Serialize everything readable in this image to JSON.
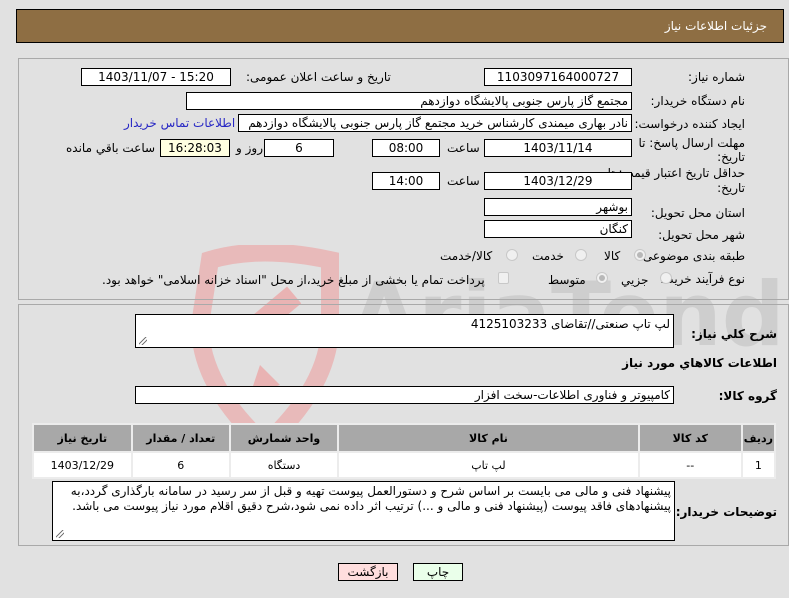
{
  "header": {
    "title": "جزئیات اطلاعات نیاز"
  },
  "form": {
    "need_number": {
      "label": "شماره نیاز:",
      "value": "1103097164000727"
    },
    "announce": {
      "label": "تاریخ و ساعت اعلان عمومی:",
      "value": "1403/11/07 - 15:20"
    },
    "buyer_org": {
      "label": "نام دستگاه خریدار:",
      "value": "مجتمع گاز پارس جنوبی  پالایشگاه دوازدهم"
    },
    "requester": {
      "label": "ایجاد کننده درخواست:",
      "value": "نادر بهاری میمندی کارشناس خرید مجتمع گاز پارس جنوبی  پالایشگاه دوازدهم",
      "contact_link": "اطلاعات تماس خریدار"
    },
    "reply_deadline": {
      "label_line1": "مهلت ارسال پاسخ: تا",
      "label_line2": "تاریخ:",
      "date": "1403/11/14",
      "time_label": "ساعت",
      "time": "08:00",
      "days": "6",
      "days_label": "روز و",
      "remaining": "16:28:03",
      "remaining_label": "ساعت باقي مانده"
    },
    "price_validity": {
      "label_line1": "حداقل تاریخ اعتبار قیمت: تا",
      "label_line2": "تاریخ:",
      "date": "1403/12/29",
      "time_label": "ساعت",
      "time": "14:00"
    },
    "province": {
      "label": "استان محل تحویل:",
      "value": "بوشهر"
    },
    "city": {
      "label": "شهر محل تحویل:",
      "value": "کنگان"
    },
    "category": {
      "label": "طبقه بندی موضوعی:",
      "options": [
        "کالا",
        "خدمت",
        "کالا/خدمت"
      ],
      "selected": "کالا"
    },
    "process": {
      "label": "نوع فرآیند خرید :",
      "options": [
        "جزیي",
        "متوسط"
      ],
      "selected": "متوسط",
      "checkbox_label": "پرداخت تمام یا بخشی از مبلغ خرید،از محل \"اسناد خزانه اسلامی\" خواهد بود.",
      "checkbox_checked": false
    }
  },
  "details": {
    "summary_label": "شرح کلي نياز:",
    "summary_value": "لپ تاپ صنعتی//تقاضای 4125103233",
    "items_title": "اطلاعات کالاهاي مورد نياز",
    "group_label": "گروه کالا:",
    "group_value": "کامپیوتر و فناوری اطلاعات-سخت افزار",
    "table": {
      "headers": [
        "ردیف",
        "کد کالا",
        "نام کالا",
        "واحد شمارش",
        "تعداد / مقدار",
        "تاریخ نیاز"
      ],
      "rows": [
        [
          "1",
          "--",
          "لپ تاپ",
          "دستگاه",
          "6",
          "1403/12/29"
        ]
      ]
    },
    "buyer_notes_label": "توضیحات خریدار:",
    "buyer_notes": "پیشنهاد فنی و مالی می بایست بر اساس شرح و دستورالعمل پیوست تهیه و قبل از سر رسید در سامانه بارگذاری گردد،به پیشنهادهای فاقد پیوست (پیشنهاد فنی و مالی و ...) ترتیب اثر داده نمی شود،شرح دقیق اقلام مورد نیاز پیوست می باشد."
  },
  "buttons": {
    "print": "چاپ",
    "back": "بازگشت"
  },
  "colors": {
    "header_bg": "#8e6e43",
    "link": "#2727c4",
    "print_bg": "#eaffea",
    "back_bg": "#ffdede"
  }
}
